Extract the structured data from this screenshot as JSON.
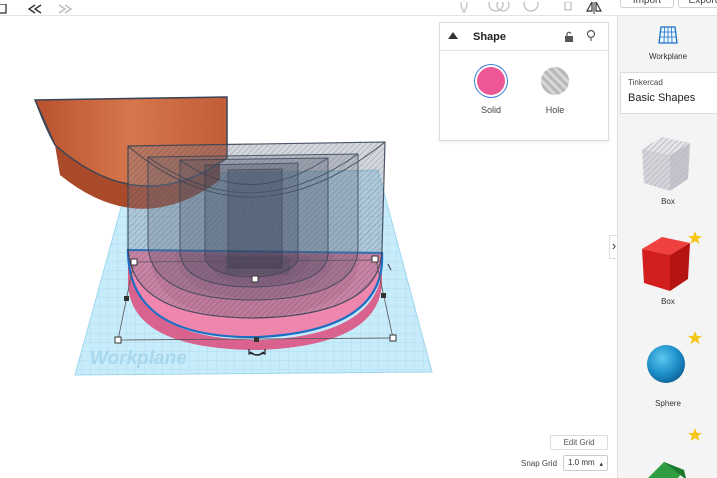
{
  "toolbar": {
    "import_label": "Import",
    "export_label": "Export",
    "icons": [
      "panel-icon",
      "undo-icon",
      "redo-icon",
      "lightbulb-icon",
      "group-icon",
      "ungroup-icon",
      "align-icon",
      "mirror-icon"
    ]
  },
  "canvas": {
    "workplane_label": "Workplane",
    "edit_grid_label": "Edit Grid",
    "snap_grid_label": "Snap Grid",
    "snap_grid_value": "1.0 mm"
  },
  "inspector": {
    "title": "Shape",
    "solid_label": "Solid",
    "hole_label": "Hole",
    "solid_color": "#ee5796"
  },
  "right_panel": {
    "workplane_label": "Workplane",
    "library_category": "Tinkercad",
    "library_name": "Basic Shapes",
    "items": [
      {
        "label": "Box",
        "kind": "hole-box"
      },
      {
        "label": "Box",
        "kind": "red-box"
      },
      {
        "label": "Sphere",
        "kind": "blue-sphere"
      }
    ],
    "star_color": "#f5c518"
  },
  "colors": {
    "workplane_grid": "#bfe6f7",
    "selection_accent": "#3a7bd5",
    "orange_shape": "#c8623e",
    "pink_shape": "#e97aa5"
  }
}
